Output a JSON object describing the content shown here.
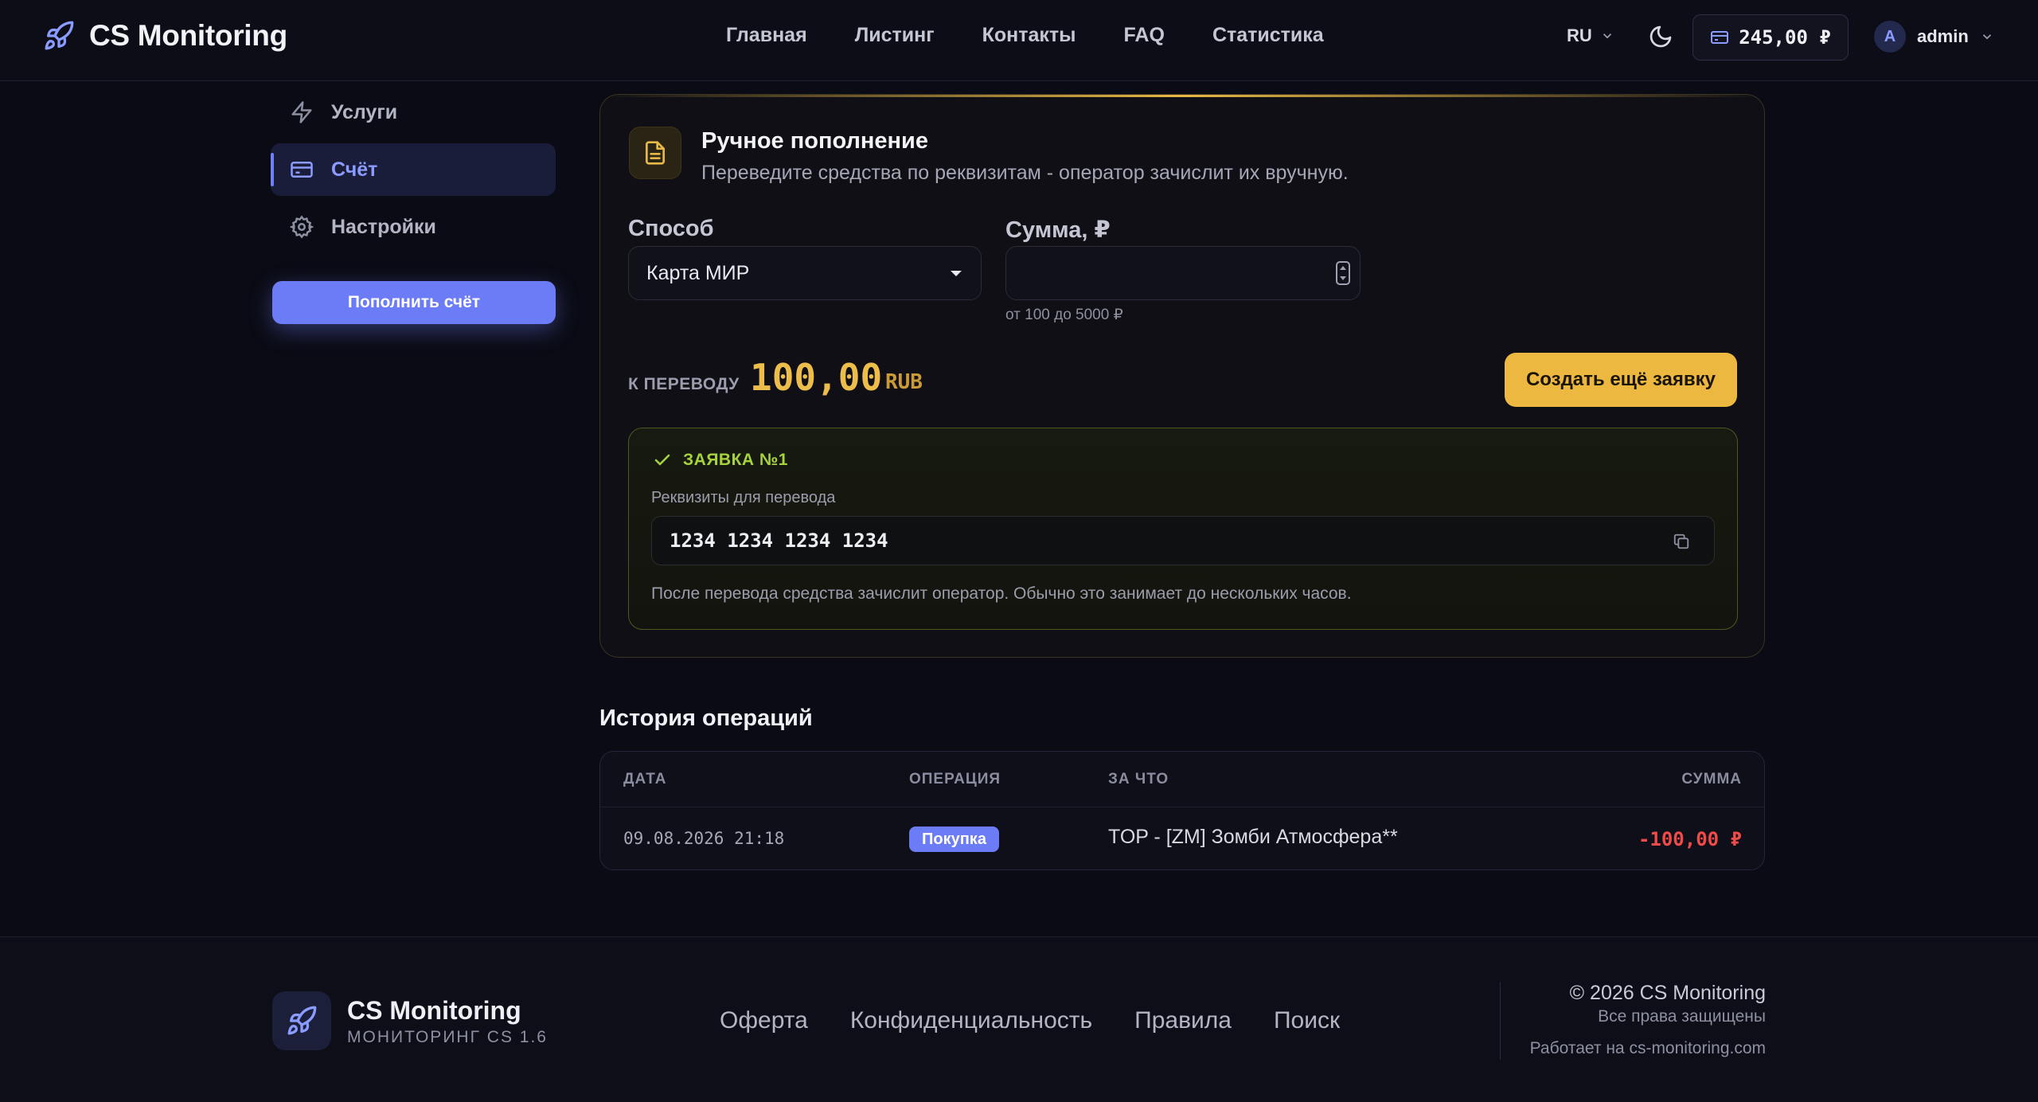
{
  "header": {
    "brand": "CS Monitoring",
    "nav": [
      "Главная",
      "Листинг",
      "Контакты",
      "FAQ",
      "Статистика"
    ],
    "lang": "RU",
    "balance": "245,00 ₽",
    "user_initial": "A",
    "username": "admin"
  },
  "sidebar": {
    "items": [
      {
        "label": "Услуги",
        "icon": "bolt-icon"
      },
      {
        "label": "Счёт",
        "icon": "card-icon",
        "active": true
      },
      {
        "label": "Настройки",
        "icon": "gear-icon"
      }
    ],
    "topup_button": "Пополнить счёт"
  },
  "manual": {
    "title": "Ручное пополнение",
    "subtitle": "Переведите средства по реквизитам - оператор зачислит их вручную.",
    "method_label": "Способ",
    "method_value": "Карта МИР",
    "amount_label": "Сумма, ₽",
    "amount_value": "",
    "amount_hint": "от 100 до 5000 ₽",
    "transfer_label": "К ПЕРЕВОДУ",
    "transfer_amount": "100,00",
    "transfer_currency": "RUB",
    "create_button": "Создать ещё заявку"
  },
  "ticket": {
    "title": "ЗАЯВКА №1",
    "requisites_label": "Реквизиты для перевода",
    "requisites_value": "1234 1234 1234 1234",
    "note": "После перевода средства зачислит оператор. Обычно это занимает до нескольких часов."
  },
  "history": {
    "title": "История операций",
    "columns": [
      "ДАТА",
      "ОПЕРАЦИЯ",
      "ЗА ЧТО",
      "СУММА"
    ],
    "rows": [
      {
        "date": "09.08.2026 21:18",
        "operation": "Покупка",
        "description": "TOP - [ZM] Зомби Атмосфера**",
        "amount": "-100,00 ₽"
      }
    ]
  },
  "footer": {
    "brand": "CS Monitoring",
    "tagline": "МОНИТОРИНГ CS 1.6",
    "links": [
      "Оферта",
      "Конфиденциальность",
      "Правила",
      "Поиск"
    ],
    "copyright": "© 2026 CS Monitoring",
    "rights": "Все права защищены",
    "powered": "Работает на cs-monitoring.com"
  },
  "colors": {
    "accent": "#6b7cf6",
    "gold": "#edb83f",
    "success": "#a6d23e",
    "danger": "#ef4b4b"
  }
}
